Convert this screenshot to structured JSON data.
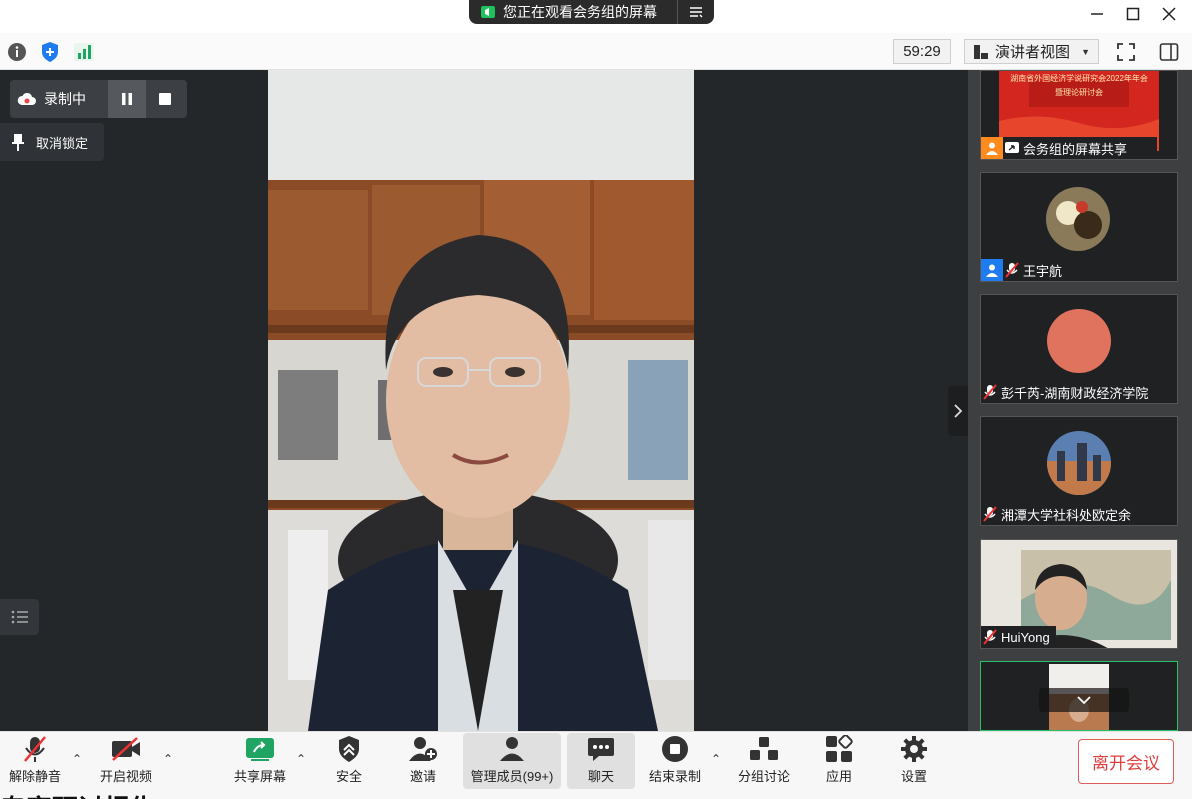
{
  "share_banner": {
    "text": "您正在观看会务组的屏幕"
  },
  "topbar": {
    "timer": "59:29",
    "view_label": "演讲者视图"
  },
  "recording": {
    "label": "录制中"
  },
  "unpin": {
    "label": "取消锁定"
  },
  "participants": [
    {
      "name": "会务组的屏幕共享",
      "slide_title": "湖南省外国经济学说研究会2022年年会",
      "slide_sub": "暨理论研讨会",
      "avatar_color": "#ff8a1e"
    },
    {
      "name": "王宇航",
      "avatar_color": "#1f7cf0"
    },
    {
      "name": "彭千芮-湖南财政经济学院",
      "avatar_color": "#e0735e"
    },
    {
      "name": "湘潭大学社科处欧定余"
    },
    {
      "name": "HuiYong"
    }
  ],
  "toolbar": {
    "unmute": "解除静音",
    "start_video": "开启视频",
    "share_screen": "共享屏幕",
    "security": "安全",
    "invite": "邀请",
    "participants": "管理成员(99+)",
    "chat": "聊天",
    "stop_record": "结束录制",
    "breakout": "分组讨论",
    "apps": "应用",
    "settings": "设置",
    "leave": "离开会议"
  },
  "footer_text": "专家研讨报告",
  "colors": {
    "accent_green": "#1fa463",
    "leave_red": "#e03e3e",
    "main_bg": "#24272a"
  }
}
